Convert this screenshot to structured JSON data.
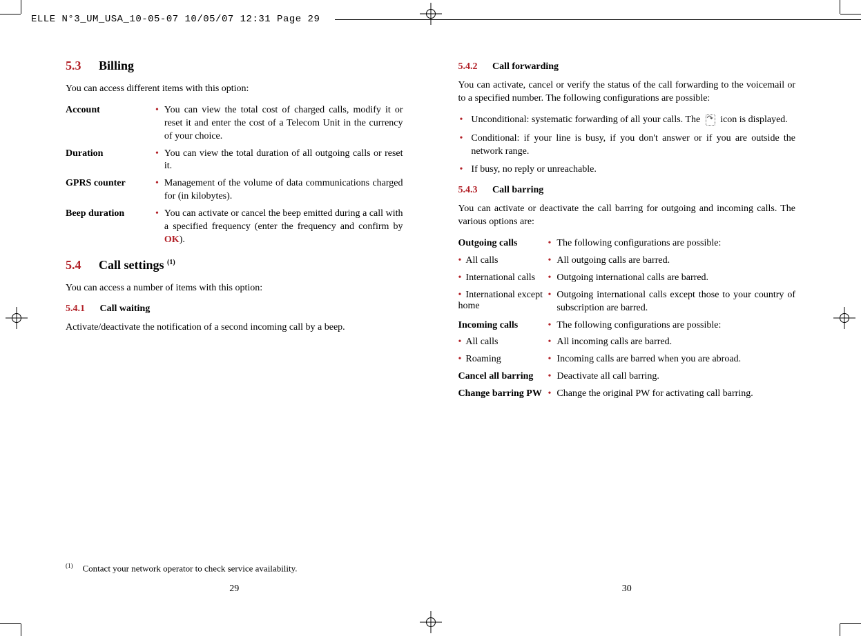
{
  "header": "ELLE N°3_UM_USA_10-05-07  10/05/07  12:31  Page 29",
  "left": {
    "s53": {
      "num": "5.3",
      "title": "Billing"
    },
    "intro53": "You can access different items with this option:",
    "rows53": [
      {
        "term": "Account",
        "desc": "You can view the total cost of charged calls, modify it or reset it and enter the cost of a Telecom Unit in the currency of your choice."
      },
      {
        "term": "Duration",
        "desc": "You can view the total duration of all outgoing calls or reset it."
      },
      {
        "term": "GPRS counter",
        "desc": "Management of the volume of data communications charged for (in kilobytes)."
      },
      {
        "term": "Beep duration",
        "desc_pre": "You can activate or cancel the beep emitted during a call with a specified frequency (enter the frequency and confirm by ",
        "ok": "OK",
        "desc_post": ")."
      }
    ],
    "s54": {
      "num": "5.4",
      "title_pre": "Call settings ",
      "sup": "(1)"
    },
    "intro54": "You can access a number of items with this option:",
    "s541": {
      "num": "5.4.1",
      "title": "Call waiting"
    },
    "body541": "Activate/deactivate the notification of a second incoming call by a beep.",
    "footnote": {
      "mark": "(1)",
      "text": "Contact your network operator to check service availability."
    },
    "pagenum": "29"
  },
  "right": {
    "s542": {
      "num": "5.4.2",
      "title": "Call forwarding"
    },
    "body542": "You can activate, cancel or verify the status of the call forwarding to the voicemail or to a specified number. The following configurations are possible:",
    "bullets542": [
      {
        "pre": "Unconditional: systematic forwarding of all your calls. The ",
        "post": " icon is displayed.",
        "icon": true
      },
      {
        "text": "Conditional: if your line is busy, if you don't answer or if you are outside the network range."
      },
      {
        "text": "If busy, no reply or unreachable."
      }
    ],
    "s543": {
      "num": "5.4.3",
      "title": "Call barring"
    },
    "body543": "You can activate or deactivate the call barring for outgoing and incoming calls. The various options are:",
    "rows543": [
      {
        "term": "Outgoing calls",
        "bold": true,
        "desc": "The following configurations are possible:"
      },
      {
        "term": "All calls",
        "bold": false,
        "dot": true,
        "desc": "All outgoing calls are barred."
      },
      {
        "term": "International calls",
        "bold": false,
        "dot": true,
        "desc": "Outgoing international calls are barred."
      },
      {
        "term": "International except home",
        "bold": false,
        "dot": true,
        "desc": "Outgoing international calls except those to your country of subscription are barred."
      },
      {
        "term": "Incoming calls",
        "bold": true,
        "desc": "The following configurations are possible:"
      },
      {
        "term": "All calls",
        "bold": false,
        "dot": true,
        "desc": "All incoming calls are barred."
      },
      {
        "term": "Roaming",
        "bold": false,
        "dot": true,
        "desc": "Incoming calls are barred when you are abroad."
      },
      {
        "term": "Cancel all barring",
        "bold": true,
        "desc": "Deactivate all call barring."
      },
      {
        "term": "Change barring PW",
        "bold": true,
        "desc": "Change the original PW for activating call barring."
      }
    ],
    "pagenum": "30"
  }
}
